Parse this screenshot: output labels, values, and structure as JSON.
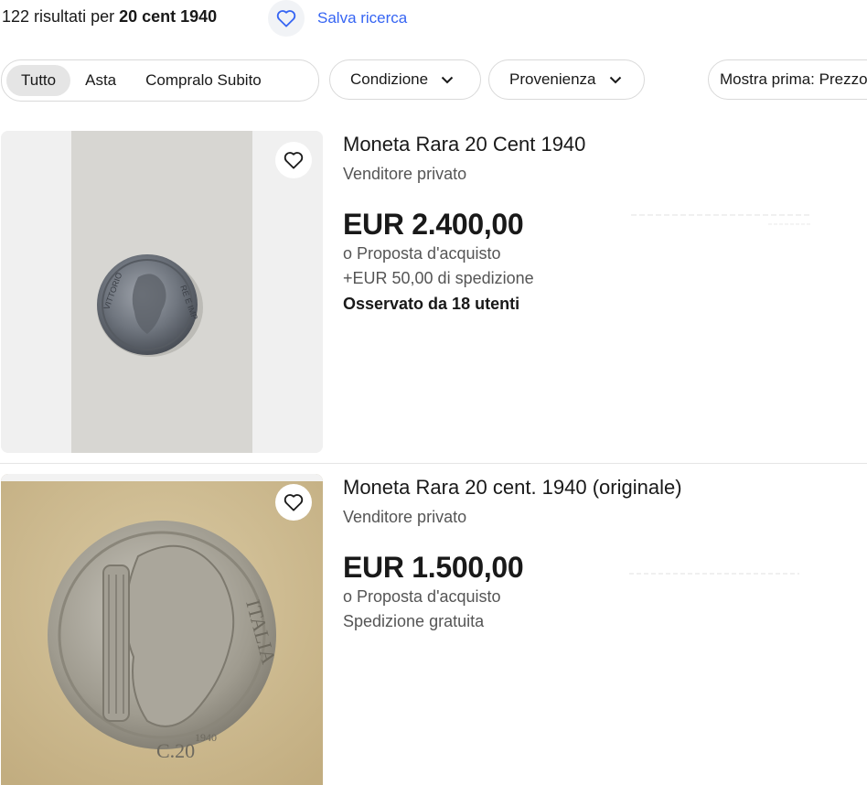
{
  "header": {
    "count": "122",
    "results_text": " risultati per ",
    "query": "20 cent 1940",
    "save_label": "Salva ricerca"
  },
  "filters": {
    "tabs": [
      "Tutto",
      "Asta",
      "Compralo Subito"
    ],
    "condition": "Condizione",
    "origin": "Provenienza",
    "sort": "Mostra prima: Prezzo"
  },
  "icons": {
    "save": "heart-outline-icon",
    "favorite": "heart-outline-icon",
    "dropdown": "chevron-down-icon"
  },
  "colors": {
    "link": "#3665f3",
    "text": "#191919",
    "secondary": "#555555"
  },
  "listings": [
    {
      "title": "Moneta Rara 20 Cent 1940",
      "seller": "Venditore privato",
      "price": "EUR 2.400,00",
      "offer": "o Proposta d'acquisto",
      "shipping": "+EUR 50,00 di spedizione",
      "watchers": "Osservato da 18 utenti"
    },
    {
      "title": "Moneta Rara 20 cent. 1940 (originale)",
      "seller": "Venditore privato",
      "price": "EUR 1.500,00",
      "offer": "o Proposta d'acquisto",
      "shipping": "Spedizione gratuita"
    }
  ]
}
